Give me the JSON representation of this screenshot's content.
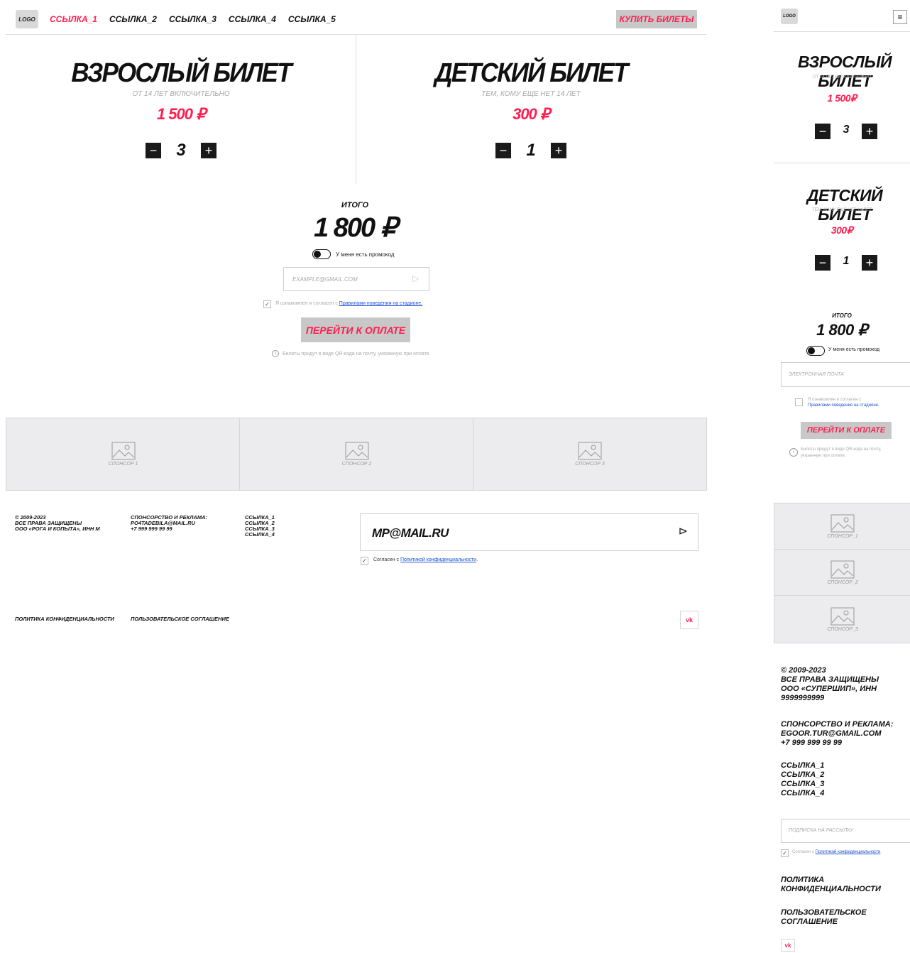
{
  "desktop": {
    "logo": "LOGO",
    "nav": [
      "ССЫЛКА_1",
      "ССЫЛКА_2",
      "ССЫЛКА_3",
      "ССЫЛКА_4",
      "ССЫЛКА_5"
    ],
    "buy_button": "КУПИТЬ БИЛЕТЫ",
    "adult": {
      "title": "ВЗРОСЛЫЙ БИЛЕТ",
      "subtitle": "ОТ 14 ЛЕТ ВКЛЮЧИТЕЛЬНО",
      "price": "1 500 ₽",
      "qty": "3"
    },
    "child": {
      "title": "ДЕТСКИЙ БИЛЕТ",
      "subtitle": "ТЕМ, КОМУ ЕЩЕ НЕТ 14 ЛЕТ",
      "price": "300 ₽",
      "qty": "1"
    },
    "stepper": {
      "minus": "−",
      "plus": "+"
    },
    "total_label": "ИТОГО",
    "total_value": "1 800 ₽",
    "promo_label": "У меня есть промокод",
    "email_placeholder": "EXAMPLE@GMAIL.COM",
    "send_icon": "▷",
    "agree_text": "Я ознакомлен и согласен с ",
    "agree_link": "Правилами поведения на стадионе.",
    "check": "✓",
    "pay_button": "ПЕРЕЙТИ К ОПЛАТЕ",
    "info_icon": "i",
    "info_text": "Билеты придут в виде QR-кода на почту, указанную при оплате.",
    "sponsors": [
      "СПОНСОР 1",
      "СПОНСОР 2",
      "СПОНСОР 3"
    ],
    "footer": {
      "copyright": [
        "© 2009-2023",
        "ВСЕ ПРАВА ЗАЩИЩЕНЫ",
        "ООО «РОГА И КОПЫТА», ИНН М"
      ],
      "sponsorship": [
        "СПОНСОРСТВО И РЕКЛАМА:",
        "PO4TADEBILA@MAIL.RU",
        "+7 999 999 99 99"
      ],
      "links": [
        "ССЫЛКА_1",
        "ССЫЛКА_2",
        "ССЫЛКА_3",
        "ССЫЛКА_4"
      ],
      "subscribe_value": "MP@MAIL.RU",
      "subscribe_arrow": "⊳",
      "agree_text": "Согласен с ",
      "agree_link": "Политикой конфиденциальности",
      "agree_end": ".",
      "privacy": "ПОЛИТИКА КОНФИДЕНЦИАЛЬНОСТИ",
      "terms": "ПОЛЬЗОВАТЕЛЬСКОЕ СОГЛАШЕНИЕ",
      "vk": "vk"
    }
  },
  "mobile": {
    "logo": "LOGO",
    "menu_icon": "≡",
    "adult": {
      "title": "ВЗРОСЛЫЙ БИЛЕТ",
      "subtitle": "ОТ 14 ЛЕТ ВКЛЮЧИТЕЛЬНО",
      "price": "1 500₽",
      "qty": "3"
    },
    "child": {
      "title": "ДЕТСКИЙ БИЛЕТ",
      "subtitle": "ТЕМ, КОМУ ЕЩЕ НЕТ 14 ЛЕТ",
      "price": "300₽",
      "qty": "1"
    },
    "total_label": "ИТОГО",
    "total_value": "1 800 ₽",
    "promo_label": "У меня есть промокод",
    "email_placeholder": "ЭЛЕКТРОННАЯ ПОЧТА",
    "agree_text": "Я ознакомлен и согласен с",
    "agree_link": "Правилами поведения на стадионе.",
    "pay_button": "ПЕРЕЙТИ К ОПЛАТЕ",
    "info_line1": "Билеты придут в виде QR-кода на почту,",
    "info_line2": "указанную при оплате.",
    "sponsors": [
      "СПОНСОР_1",
      "СПОНСОР_2",
      "СПОНСОР_3"
    ],
    "footer": {
      "copyright": [
        "© 2009-2023",
        "ВСЕ ПРАВА ЗАЩИЩЕНЫ",
        "ООО «СУПЕРШИП», ИНН",
        "9999999999"
      ],
      "sponsorship": [
        "СПОНСОРСТВО И РЕКЛАМА:",
        "EGOOR.TUR@GMAIL.COM",
        "+7 999 999 99 99"
      ],
      "links": [
        "ССЫЛКА_1",
        "ССЫЛКА_2",
        "ССЫЛКА_3",
        "ССЫЛКА_4"
      ],
      "subscribe_placeholder": "ПОДПИСКА НА РАССЫЛКУ",
      "agree_text": "Согласен с ",
      "agree_link": "Политикой конфиденциальности",
      "agree_end": ".",
      "privacy": [
        "ПОЛИТИКА",
        "КОНФИДЕНЦИАЛЬНОСТИ"
      ],
      "terms": [
        "ПОЛЬЗОВАТЕЛЬСКОЕ",
        "СОГЛАШЕНИЕ"
      ],
      "vk": "vk"
    }
  },
  "colors": {
    "accent": "#ff1e50",
    "button_gray": "#c8c8c8",
    "sponsor_bg": "#ececef",
    "link": "#1a4fd6"
  }
}
